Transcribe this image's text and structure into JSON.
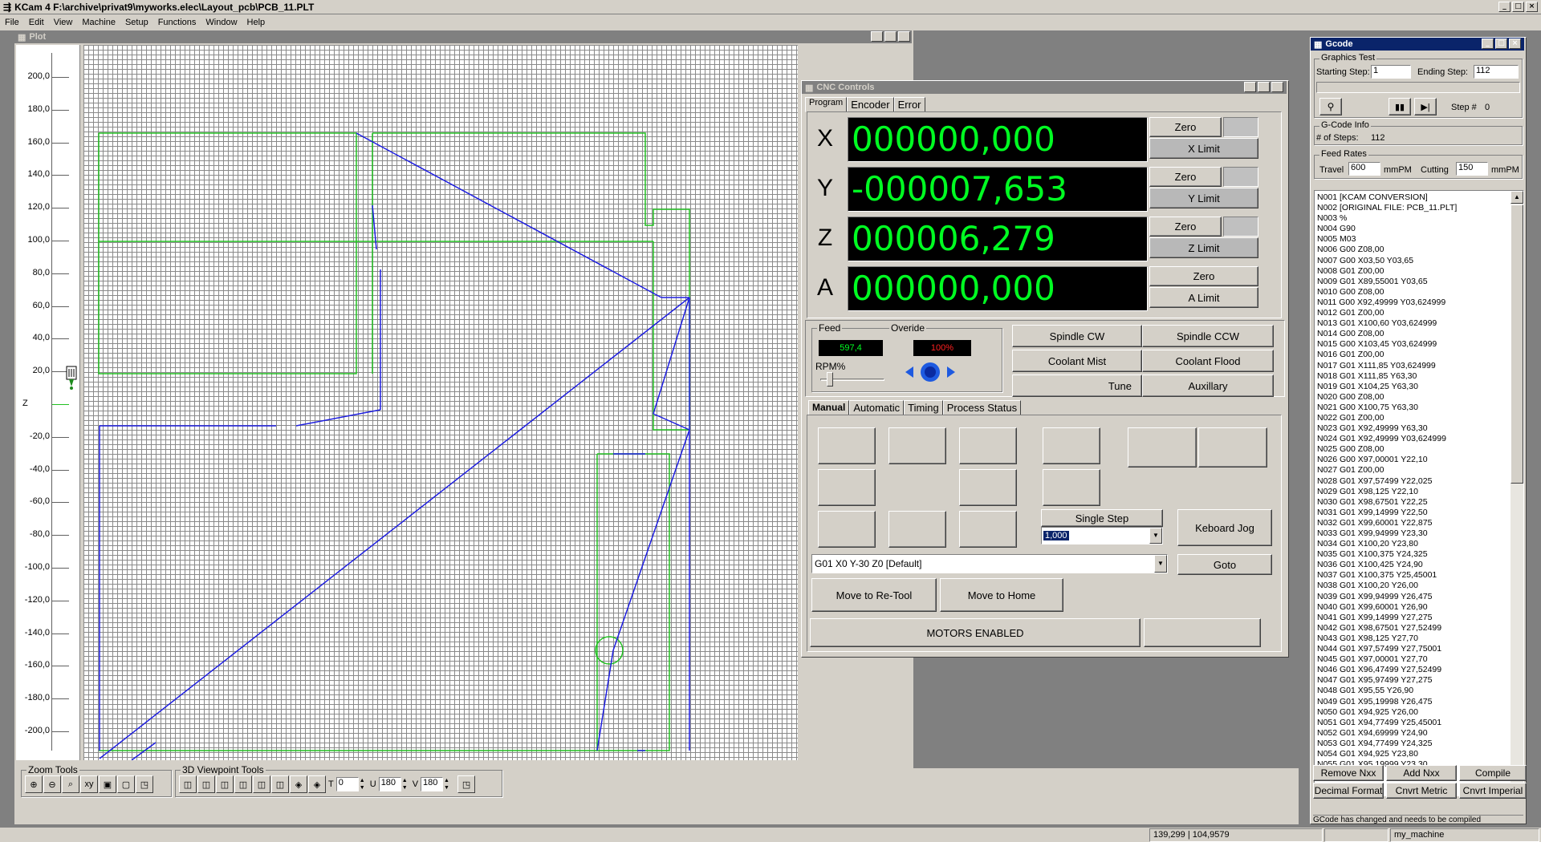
{
  "app": {
    "title": "KCam 4  F:\\archive\\privat9\\myworks.elec\\Layout_pcb\\PCB_11.PLT"
  },
  "menu": [
    "File",
    "Edit",
    "View",
    "Machine",
    "Setup",
    "Functions",
    "Window",
    "Help"
  ],
  "plot": {
    "title": "Plot",
    "y_ticks": [
      "200,0",
      "180,0",
      "160,0",
      "140,0",
      "120,0",
      "100,0",
      "80,0",
      "60,0",
      "40,0",
      "20,0",
      "Z",
      "-20,0",
      "-40,0",
      "-60,0",
      "-80,0",
      "-100,0",
      "-120,0",
      "-140,0",
      "-160,0",
      "-180,0",
      "-200,0"
    ]
  },
  "zoom_tools": {
    "label": "Zoom Tools"
  },
  "viewpoint_tools": {
    "label": "3D Viewpoint Tools",
    "t_label": "T",
    "t_value": "0",
    "u_label": "U",
    "u_value": "180",
    "v_label": "V",
    "v_value": "180"
  },
  "cnc": {
    "title": "CNC Controls",
    "tabs": [
      "Program",
      "Encoder",
      "Error"
    ],
    "axes": [
      {
        "name": "X",
        "value": "000000,000",
        "zero": "Zero",
        "limit": "X Limit"
      },
      {
        "name": "Y",
        "value": "-000007,653",
        "zero": "Zero",
        "limit": "Y Limit"
      },
      {
        "name": "Z",
        "value": "000006,279",
        "zero": "Zero",
        "limit": "Z Limit"
      },
      {
        "name": "A",
        "value": "000000,000",
        "zero": "Zero",
        "limit": "A Limit"
      }
    ],
    "feed_label": "Feed",
    "feed_value": "597,4",
    "override_label": "Overide",
    "override_value": "100%",
    "rpm_label": "RPM%",
    "buttons": {
      "spindle_cw": "Spindle CW",
      "spindle_ccw": "Spindle CCW",
      "coolant_mist": "Coolant Mist",
      "coolant_flood": "Coolant Flood",
      "tune": "Tune",
      "auxiliary": "Auxillary"
    },
    "mode_tabs": [
      "Manual",
      "Automatic",
      "Timing",
      "Process Status"
    ],
    "single_step": "Single Step",
    "step_value": "1,000",
    "keyboard_jog": "Keboard Jog",
    "command": "G01 X0 Y-30 Z0 [Default]",
    "goto": "Goto",
    "move_retool": "Move to Re-Tool",
    "move_home": "Move to Home",
    "motors": "MOTORS ENABLED"
  },
  "gcode": {
    "title": "Gcode",
    "graphics_test": "Graphics Test",
    "starting_step_label": "Starting Step:",
    "starting_step": "1",
    "ending_step_label": "Ending Step:",
    "ending_step": "112",
    "step_label": "Step #",
    "step_value": "0",
    "info_label": "G-Code Info",
    "num_steps_label": "# of Steps:",
    "num_steps": "112",
    "feed_rates_label": "Feed Rates",
    "travel_label": "Travel",
    "travel": "600",
    "travel_unit": "mmPM",
    "cutting_label": "Cutting",
    "cutting": "150",
    "cutting_unit": "mmPM",
    "lines": [
      "N001 [KCAM CONVERSION]",
      "N002 [ORIGINAL FILE: PCB_11.PLT]",
      "N003 %",
      "N004 G90",
      "N005 M03",
      "N006 G00 Z08,00",
      "N007 G00 X03,50 Y03,65",
      "N008 G01 Z00,00",
      "N009 G01 X89,55001 Y03,65",
      "N010 G00 Z08,00",
      "N011 G00 X92,49999 Y03,624999",
      "N012 G01 Z00,00",
      "N013 G01 X100,60 Y03,624999",
      "N014 G00 Z08,00",
      "N015 G00 X103,45 Y03,624999",
      "N016 G01 Z00,00",
      "N017 G01 X111,85 Y03,624999",
      "N018 G01 X111,85 Y63,30",
      "N019 G01 X104,25 Y63,30",
      "N020 G00 Z08,00",
      "N021 G00 X100,75 Y63,30",
      "N022 G01 Z00,00",
      "N023 G01 X92,49999 Y63,30",
      "N024 G01 X92,49999 Y03,624999",
      "N025 G00 Z08,00",
      "N026 G00 X97,00001 Y22,10",
      "N027 G01 Z00,00",
      "N028 G01 X97,57499 Y22,025",
      "N029 G01 X98,125 Y22,10",
      "N030 G01 X98,67501 Y22,25",
      "N031 G01 X99,14999 Y22,50",
      "N032 G01 X99,60001 Y22,875",
      "N033 G01 X99,94999 Y23,30",
      "N034 G01 X100,20 Y23,80",
      "N035 G01 X100,375 Y24,325",
      "N036 G01 X100,425 Y24,90",
      "N037 G01 X100,375 Y25,45001",
      "N038 G01 X100,20 Y26,00",
      "N039 G01 X99,94999 Y26,475",
      "N040 G01 X99,60001 Y26,90",
      "N041 G01 X99,14999 Y27,275",
      "N042 G01 X98,67501 Y27,52499",
      "N043 G01 X98,125 Y27,70",
      "N044 G01 X97,57499 Y27,75001",
      "N045 G01 X97,00001 Y27,70",
      "N046 G01 X96,47499 Y27,52499",
      "N047 G01 X95,97499 Y27,275",
      "N048 G01 X95,55 Y26,90",
      "N049 G01 X95,19998 Y26,475",
      "N050 G01 X94,925 Y26,00",
      "N051 G01 X94,77499 Y25,45001",
      "N052 G01 X94,69999 Y24,90",
      "N053 G01 X94,77499 Y24,325",
      "N054 G01 X94,925 Y23,80",
      "N055 G01 X95,19999 Y23,30"
    ],
    "remove_nxx": "Remove  Nxx",
    "add_nxx": "Add Nxx",
    "compile": "Compile",
    "decimal_format": "Decimal Format",
    "cnvt_metric": "Cnvrt Metric",
    "cnvt_imperial": "Cnvrt Imperial",
    "message": "GCode has changed and needs to be compiled"
  },
  "status": {
    "coords": "139,299 | 104,9579",
    "machine": "my_machine"
  }
}
